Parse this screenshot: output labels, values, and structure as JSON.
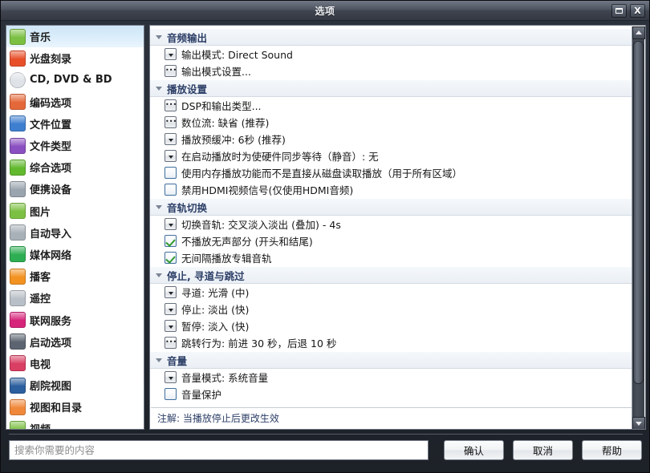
{
  "window": {
    "title": "选项",
    "controls": [
      {
        "name": "restore-button",
        "label": ""
      },
      {
        "name": "close-button",
        "label": "X"
      }
    ]
  },
  "sidebar": {
    "items": [
      {
        "label": "音乐",
        "icon": "music-icon",
        "color": "#7cc043",
        "selected": true
      },
      {
        "label": "光盘刻录",
        "icon": "disc-burn-icon",
        "color": "#e8502a",
        "selected": false
      },
      {
        "label": "CD, DVD & BD",
        "icon": "optical-disc-icon",
        "color": "#dfe3e8",
        "selected": false
      },
      {
        "label": "编码选项",
        "icon": "encoding-icon",
        "color": "#e4683a",
        "selected": false
      },
      {
        "label": "文件位置",
        "icon": "file-location-icon",
        "color": "#3f7fd0",
        "selected": false
      },
      {
        "label": "文件类型",
        "icon": "file-types-icon",
        "color": "#8a4fc0",
        "selected": false
      },
      {
        "label": "综合选项",
        "icon": "general-options-icon",
        "color": "#62b92e",
        "selected": false
      },
      {
        "label": "便携设备",
        "icon": "portable-device-icon",
        "color": "#9aa4ae",
        "selected": false
      },
      {
        "label": "图片",
        "icon": "pictures-icon",
        "color": "#7cc043",
        "selected": false
      },
      {
        "label": "自动导入",
        "icon": "auto-import-icon",
        "color": "#a8b0b8",
        "selected": false
      },
      {
        "label": "媒体网络",
        "icon": "media-network-icon",
        "color": "#2eae52",
        "selected": false
      },
      {
        "label": "播客",
        "icon": "podcast-icon",
        "color": "#f29221",
        "selected": false
      },
      {
        "label": "遥控",
        "icon": "remote-control-icon",
        "color": "#b9bfc6",
        "selected": false
      },
      {
        "label": "联网服务",
        "icon": "online-services-icon",
        "color": "#d6247a",
        "selected": false
      },
      {
        "label": "启动选项",
        "icon": "startup-options-icon",
        "color": "#5b6470",
        "selected": false
      },
      {
        "label": "电视",
        "icon": "tv-icon",
        "color": "#d93e63",
        "selected": false
      },
      {
        "label": "剧院视图",
        "icon": "theater-view-icon",
        "color": "#2b5f9e",
        "selected": false
      },
      {
        "label": "视图和目录",
        "icon": "views-catalog-icon",
        "color": "#f0883a",
        "selected": false
      },
      {
        "label": "视频",
        "icon": "video-icon",
        "color": "#7cc043",
        "selected": false
      }
    ]
  },
  "content": {
    "groups": [
      {
        "title": "音频输出",
        "rows": [
          {
            "control": "dropdown",
            "label": "输出模式: Direct Sound"
          },
          {
            "control": "ellipsis",
            "label": "输出模式设置..."
          }
        ]
      },
      {
        "title": "播放设置",
        "rows": [
          {
            "control": "ellipsis",
            "label": "DSP和输出类型..."
          },
          {
            "control": "ellipsis",
            "label": "数位流: 缺省 (推荐)"
          },
          {
            "control": "dropdown",
            "label": "播放预缓冲: 6秒 (推荐)"
          },
          {
            "control": "dropdown",
            "label": "在启动播放时为使硬件同步等待（静音）: 无"
          },
          {
            "control": "checkbox",
            "checked": false,
            "label": "使用内存播放功能而不是直接从磁盘读取播放（用于所有区域）"
          },
          {
            "control": "checkbox",
            "checked": false,
            "label": "禁用HDMI视频信号(仅使用HDMI音频)"
          }
        ]
      },
      {
        "title": "音轨切换",
        "rows": [
          {
            "control": "dropdown",
            "label": "切换音轨: 交叉淡入淡出 (叠加) - 4s"
          },
          {
            "control": "checkbox",
            "checked": true,
            "label": "不播放无声部分 (开头和结尾)"
          },
          {
            "control": "checkbox",
            "checked": true,
            "label": "无间隔播放专辑音轨"
          }
        ]
      },
      {
        "title": "停止, 寻道与跳过",
        "rows": [
          {
            "control": "dropdown",
            "label": "寻道: 光滑 (中)"
          },
          {
            "control": "dropdown",
            "label": "停止: 淡出 (快)"
          },
          {
            "control": "dropdown",
            "label": "暂停: 淡入 (快)"
          },
          {
            "control": "ellipsis",
            "label": "跳转行为: 前进 30 秒，后退 10 秒"
          }
        ]
      },
      {
        "title": "音量",
        "rows": [
          {
            "control": "dropdown",
            "label": "音量模式: 系统音量"
          },
          {
            "control": "checkbox",
            "checked": false,
            "label": "音量保护"
          }
        ]
      }
    ],
    "note": "注解: 当播放停止后更改生效"
  },
  "bottom": {
    "search_placeholder": "搜索你需要的内容",
    "search_value": "",
    "ok_label": "确认",
    "cancel_label": "取消",
    "help_label": "帮助"
  },
  "scrollbar": {
    "up_arrow": "scroll-up-arrow",
    "down_arrow": "scroll-down-arrow"
  }
}
